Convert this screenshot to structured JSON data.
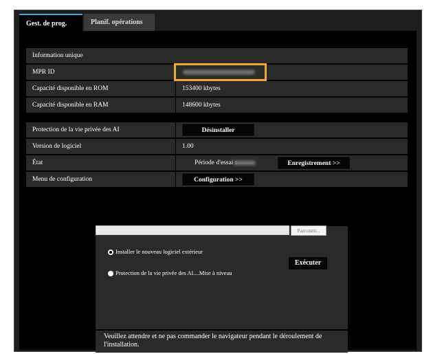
{
  "tabs": [
    {
      "label": "Gest. de prog.",
      "active": true
    },
    {
      "label": "Planif. opérations",
      "active": false
    }
  ],
  "info_section": {
    "header": "Information unique",
    "rows": [
      {
        "label": "MPR ID",
        "value": ""
      },
      {
        "label": "Capacité disponible en ROM",
        "value": "153400 kbytes"
      },
      {
        "label": "Capacité disponible en RAM",
        "value": "148600 kbytes"
      }
    ]
  },
  "app_section": {
    "privacy": {
      "label": "Protection de la vie privée des AI",
      "button": "Désinstaller"
    },
    "version": {
      "label": "Version de logiciel",
      "value": "1.00"
    },
    "state": {
      "label": "État",
      "value": "Période d'essai :",
      "button": "Enregistrement >>"
    },
    "config": {
      "label": "Menu de configuration",
      "button": "Configuration >>"
    }
  },
  "install_panel": {
    "browse_label": "Parcourir...",
    "option_new": "Installer le nouveau logiciel extérieur",
    "option_upgrade": "Protection de la vie privée des AI....Mise à niveau",
    "selected_option": "option_new",
    "execute_label": "Exécuter",
    "notice": "Veuillez attendre et ne pas commander le navigateur pendant le déroulement de l'installation."
  },
  "colors": {
    "highlight": "#f0a830",
    "active_tab_accent": "#4aa3d8"
  }
}
